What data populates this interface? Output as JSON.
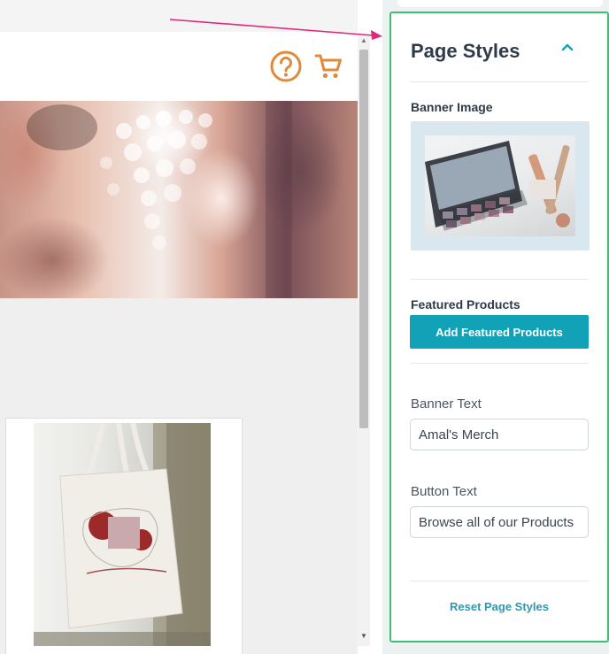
{
  "panel": {
    "title": "Page Styles",
    "banner_image_label": "Banner Image",
    "featured_products_label": "Featured Products",
    "add_featured_button": "Add Featured Products",
    "banner_text_label": "Banner Text",
    "banner_text_value": "Amal's Merch",
    "button_text_label": "Button Text",
    "button_text_value": "Browse all of our Products",
    "reset_link": "Reset Page Styles"
  },
  "preview": {
    "header_icons": [
      "help-icon",
      "cart-icon"
    ],
    "product_image": "tote-bag-photo"
  },
  "colors": {
    "accent": "#12a2b8",
    "icon_orange": "#e08a3c",
    "highlight_border": "#3cc26c",
    "arrow": "#e0287a",
    "title_text": "#2f3b4a"
  }
}
